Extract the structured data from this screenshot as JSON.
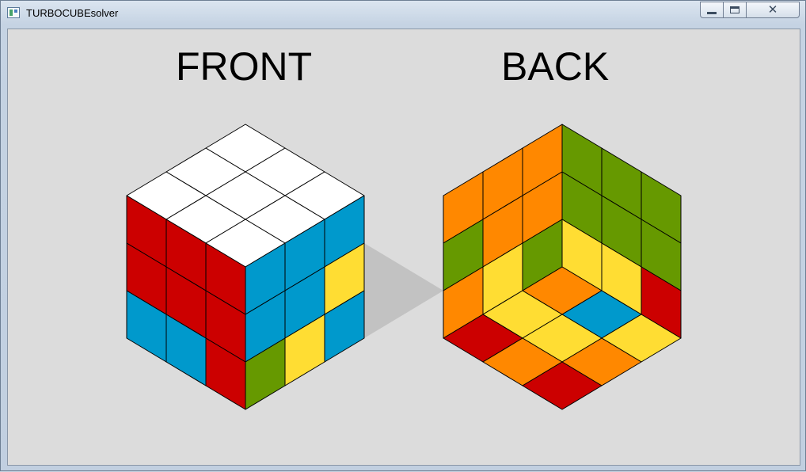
{
  "window": {
    "title": "TURBOCUBEsolver",
    "controls": {
      "minimize": "minimize",
      "maximize": "maximize",
      "close": "close"
    }
  },
  "views": {
    "front_label": "FRONT",
    "back_label": "BACK"
  },
  "colors": {
    "W": "#ffffff",
    "R": "#cc0000",
    "B": "#0099cc",
    "Y": "#ffdd33",
    "G": "#669900",
    "O": "#ff8800",
    "shadow": "#c2c2c2",
    "background": "#dcdcdc"
  },
  "cube": {
    "front": {
      "top": [
        [
          "W",
          "W",
          "W"
        ],
        [
          "W",
          "W",
          "W"
        ],
        [
          "W",
          "W",
          "W"
        ]
      ],
      "left": [
        [
          "R",
          "R",
          "R"
        ],
        [
          "R",
          "R",
          "R"
        ],
        [
          "B",
          "B",
          "R"
        ]
      ],
      "right": [
        [
          "B",
          "B",
          "B"
        ],
        [
          "B",
          "B",
          "Y"
        ],
        [
          "G",
          "Y",
          "B"
        ]
      ]
    },
    "back": {
      "upper_left": [
        [
          "O",
          "O",
          "O"
        ],
        [
          "G",
          "O",
          "O"
        ],
        [
          "O",
          "Y",
          "G"
        ]
      ],
      "upper_right": [
        [
          "G",
          "G",
          "G"
        ],
        [
          "G",
          "G",
          "G"
        ],
        [
          "Y",
          "Y",
          "R"
        ]
      ],
      "bottom": [
        [
          "O",
          "Y",
          "R"
        ],
        [
          "B",
          "Y",
          "O"
        ],
        [
          "Y",
          "O",
          "R"
        ]
      ]
    }
  }
}
